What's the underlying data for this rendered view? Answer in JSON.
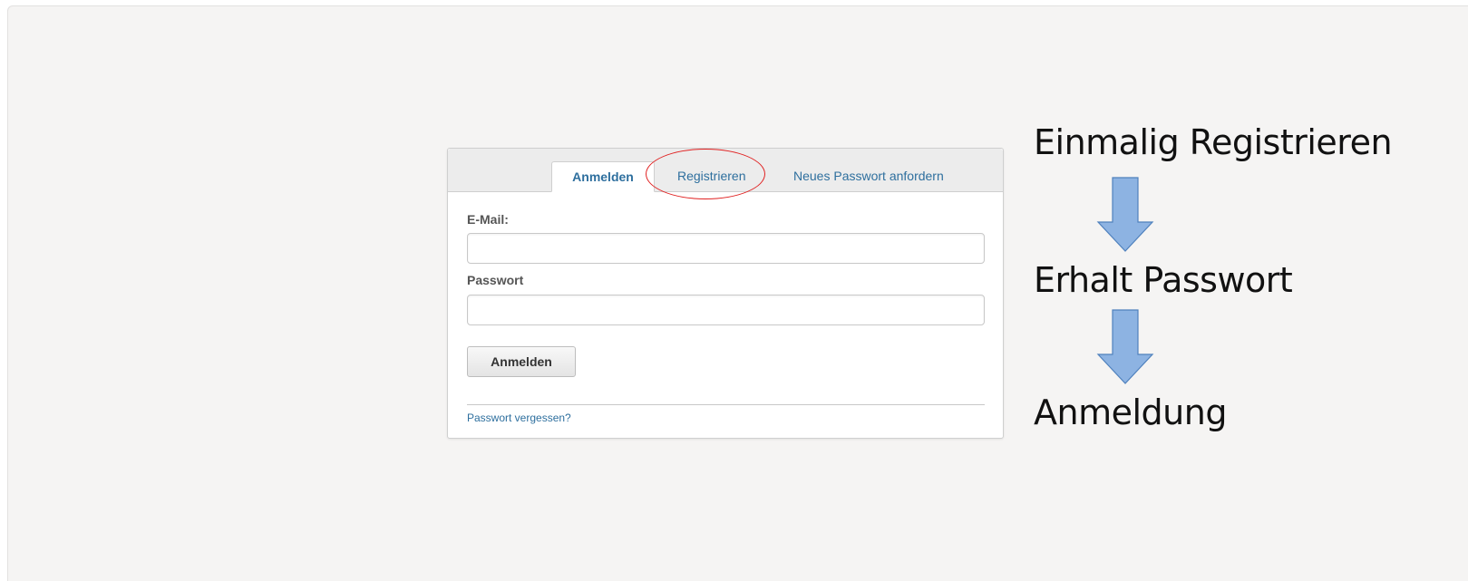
{
  "login": {
    "tabs": {
      "login": "Anmelden",
      "register": "Registrieren",
      "new_password": "Neues Passwort anfordern"
    },
    "email_label": "E-Mail:",
    "email_value": "",
    "password_label": "Passwort",
    "password_value": "",
    "submit_label": "Anmelden",
    "forgot_link": "Passwort vergessen?"
  },
  "flow": {
    "steps": [
      "Einmalig Registrieren",
      "Erhalt Passwort",
      "Anmeldung"
    ],
    "arrow_color": "#8db3e2",
    "arrow_stroke": "#4f81bd",
    "highlight_color": "#e02020"
  },
  "icons": {
    "arrow": "arrow-down-icon"
  }
}
